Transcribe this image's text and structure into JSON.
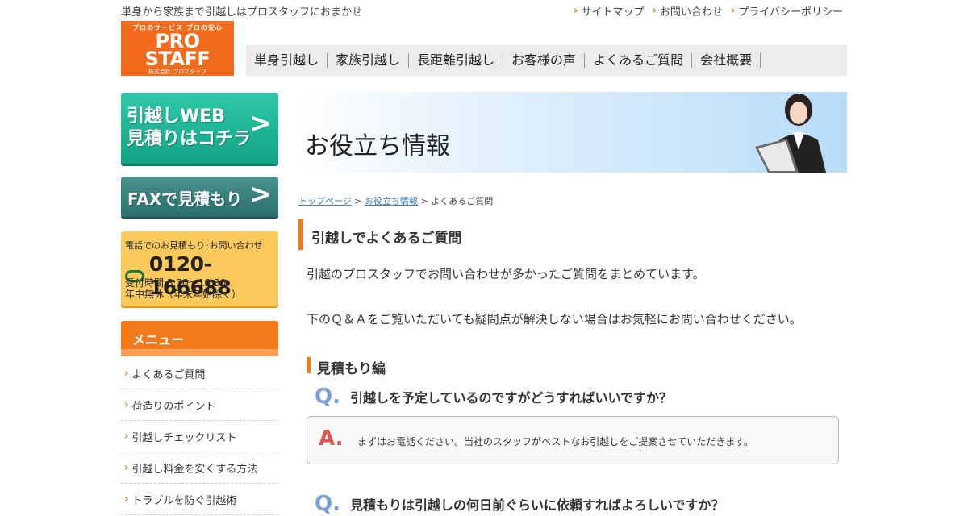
{
  "header": {
    "tagline": "単身から家族まで引越しはプロスタッフにおまかせ",
    "links": [
      "サイトマップ",
      "お問い合わせ",
      "プライバシーポリシー"
    ],
    "logo": {
      "tagline": "プロのサービス プロの安心",
      "name": "PRO STAFF",
      "corp": "株式会社 プロスタッフ",
      "tel": "0120-166688"
    }
  },
  "nav": [
    "単身引越し",
    "家族引越し",
    "長距離引越し",
    "お客様の声",
    "よくあるご質問",
    "会社概要"
  ],
  "sidebar": {
    "web_button": {
      "line1": "引越しWEB",
      "line2": "見積りはコチラ"
    },
    "fax_button": "FAXで見積もり",
    "tel_box": {
      "title": "電話でのお見積もり･お問い合わせ",
      "number": "0120-166688",
      "hours": "受付時間 8:30～19:30",
      "holidays": "年中無休（年末年始除く）"
    },
    "menu_title": "メニュー",
    "menu_items": [
      "よくあるご質問",
      "荷造りのポイント",
      "引越しチェックリスト",
      "引越し料金を安くする方法",
      "トラブルを防ぐ引越術"
    ]
  },
  "main": {
    "banner_title": "お役立ち情報",
    "breadcrumb": {
      "home": "トップページ",
      "parent": "お役立ち情報",
      "current": "よくあるご質問",
      "sep": ">"
    },
    "heading": "引越しでよくあるご質問",
    "intro1": "引越のプロスタッフでお問い合わせが多かったご質問をまとめています。",
    "intro2": "下のＱ＆Ａをご覧いただいても疑問点が解決しない場合はお気軽にお問い合わせください。",
    "section_title": "見積もり編",
    "q_mark": "Q.",
    "a_mark": "A.",
    "faq": [
      {
        "q": "引越しを予定しているのですがどうすればいいですか？",
        "a": "まずはお電話ください。当社のスタッフがベストなお引越しをご提案させていただきます。"
      },
      {
        "q": "見積もりは引越しの何日前ぐらいに依頼すればよろしいですか？"
      }
    ]
  },
  "colors": {
    "brand_orange": "#f26b1d",
    "web_green": "#13a386",
    "fax_teal": "#2a6f6c",
    "tel_yellow": "#fbc95c"
  }
}
